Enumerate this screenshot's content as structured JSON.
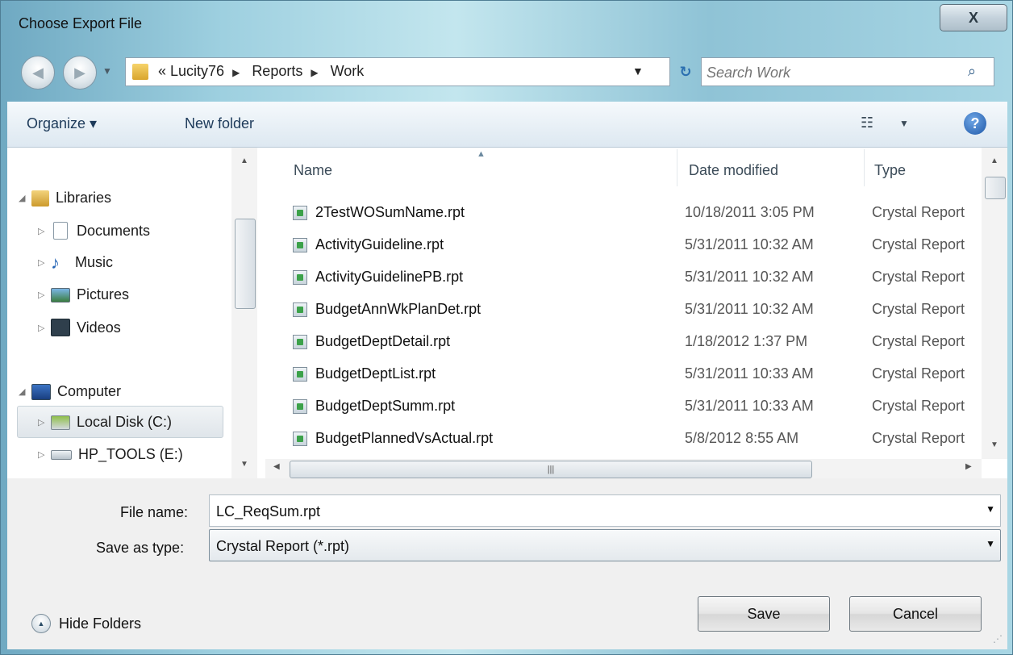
{
  "window": {
    "title": "Choose Export File",
    "close_label": "X"
  },
  "address": {
    "crumbs": [
      "« Lucity76",
      "Reports",
      "Work"
    ],
    "search_placeholder": "Search Work"
  },
  "toolbar": {
    "organize": "Organize ▾",
    "new_folder": "New folder",
    "help": "?"
  },
  "nav": {
    "libraries": "Libraries",
    "documents": "Documents",
    "music": "Music",
    "pictures": "Pictures",
    "videos": "Videos",
    "computer": "Computer",
    "local_disk": "Local Disk (C:)",
    "hp_tools": "HP_TOOLS (E:)"
  },
  "list": {
    "columns": {
      "name": "Name",
      "date": "Date modified",
      "type": "Type"
    },
    "rows": [
      {
        "name": "2TestWOSumName.rpt",
        "date": "10/18/2011 3:05 PM",
        "type": "Crystal Report"
      },
      {
        "name": "ActivityGuideline.rpt",
        "date": "5/31/2011 10:32 AM",
        "type": "Crystal Report"
      },
      {
        "name": "ActivityGuidelinePB.rpt",
        "date": "5/31/2011 10:32 AM",
        "type": "Crystal Report"
      },
      {
        "name": "BudgetAnnWkPlanDet.rpt",
        "date": "5/31/2011 10:32 AM",
        "type": "Crystal Report"
      },
      {
        "name": "BudgetDeptDetail.rpt",
        "date": "1/18/2012 1:37 PM",
        "type": "Crystal Report"
      },
      {
        "name": "BudgetDeptList.rpt",
        "date": "5/31/2011 10:33 AM",
        "type": "Crystal Report"
      },
      {
        "name": "BudgetDeptSumm.rpt",
        "date": "5/31/2011 10:33 AM",
        "type": "Crystal Report"
      },
      {
        "name": "BudgetPlannedVsActual.rpt",
        "date": "5/8/2012 8:55 AM",
        "type": "Crystal Report"
      }
    ]
  },
  "form": {
    "file_name_label": "File name:",
    "file_name_value": "LC_ReqSum.rpt",
    "save_type_label": "Save as type:",
    "save_type_value": "Crystal Report (*.rpt)"
  },
  "footer": {
    "hide_folders": "Hide Folders",
    "save": "Save",
    "cancel": "Cancel"
  }
}
